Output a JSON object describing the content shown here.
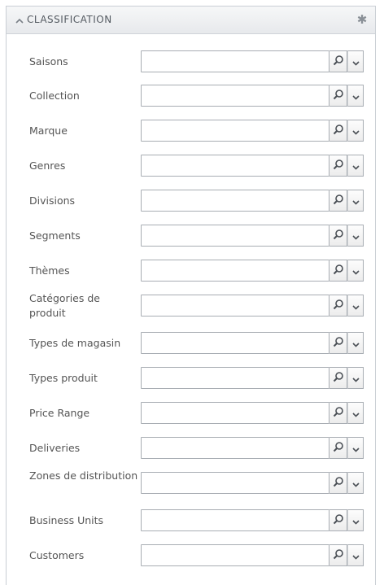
{
  "panel": {
    "title": "CLASSIFICATION",
    "collapse_icon": "chevron-up-icon",
    "settings_icon": "gear-icon"
  },
  "fields": [
    {
      "label": "Saisons",
      "value": ""
    },
    {
      "label": "Collection",
      "value": ""
    },
    {
      "label": "Marque",
      "value": ""
    },
    {
      "label": "Genres",
      "value": ""
    },
    {
      "label": "Divisions",
      "value": ""
    },
    {
      "label": "Segments",
      "value": ""
    },
    {
      "label": "Thèmes",
      "value": ""
    },
    {
      "label": "Catégories de produit",
      "value": ""
    },
    {
      "label": "Types de magasin",
      "value": ""
    },
    {
      "label": "Types produit",
      "value": ""
    },
    {
      "label": "Price Range",
      "value": ""
    },
    {
      "label": "Deliveries",
      "value": ""
    },
    {
      "label": "Zones de distribution",
      "value": ""
    },
    {
      "label": "Business Units",
      "value": ""
    },
    {
      "label": "Customers",
      "value": ""
    }
  ]
}
